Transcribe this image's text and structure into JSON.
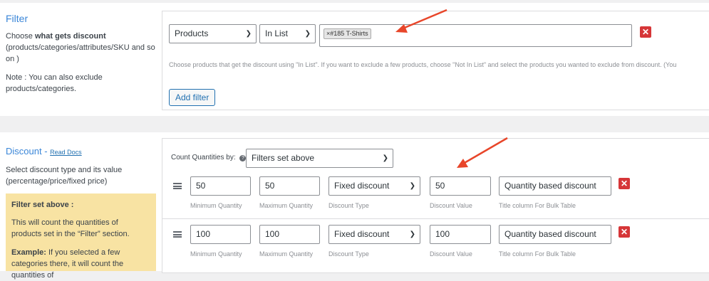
{
  "filter": {
    "title": "Filter",
    "desc_prefix": "Choose ",
    "desc_bold": "what gets discount",
    "desc_rest": "(products/categories/attributes/SKU and so on )",
    "note": "Note : You can also exclude products/categories.",
    "type_select": "Products",
    "method_select": "In List",
    "tag_remove": "×",
    "tag_label": "#185 T-Shirts",
    "help_text": "Choose products that get the discount using \"In List\". If you want to exclude a few products, choose \"Not In List\" and select the products you wanted to exclude from discount. (You",
    "add_filter": "Add filter",
    "remove_glyph": "✕"
  },
  "discount": {
    "title": "Discount",
    "separator": " - ",
    "read_docs": "Read Docs",
    "desc": "Select discount type and its value (percentage/price/fixed price)",
    "note_title": "Filter set above :",
    "note_text": "This will count the quantities of products set in the “Filter” section.",
    "note_example_bold": "Example:",
    "note_example": " If you selected a few categories there, it will count the quantities of",
    "count_label": "Count Quantities by:",
    "count_help_icon": "?",
    "count_select": "Filters set above",
    "labels": {
      "min": "Minimum Quantity",
      "max": "Maximum Quantity",
      "type": "Discount Type",
      "value": "Discount Value",
      "title": "Title column For Bulk Table"
    },
    "rows": [
      {
        "min": "50",
        "max": "50",
        "type": "Fixed discount",
        "value": "50",
        "title": "Quantity based discount"
      },
      {
        "min": "100",
        "max": "100",
        "type": "Fixed discount",
        "value": "100",
        "title": "Quantity based discount"
      }
    ],
    "remove_glyph": "✕"
  },
  "colors": {
    "accent": "#3a86d8",
    "danger": "#d63638",
    "arrow": "#e8462a",
    "note_bg": "#f8e3a3"
  }
}
